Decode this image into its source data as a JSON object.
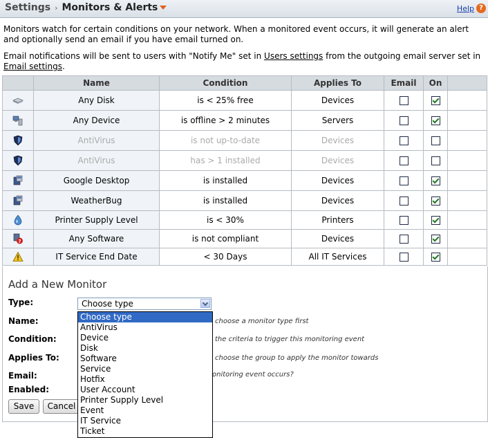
{
  "header": {
    "breadcrumb_root": "Settings",
    "breadcrumb_sep": "›",
    "breadcrumb_current": "Monitors & Alerts",
    "help_label": "Help",
    "help_icon": "?"
  },
  "intro": {
    "line1": "Monitors watch for certain conditions on your network. When a monitored event occurs, it will generate an alert and optionally send an email if you have email turned on.",
    "line2_pre": "Email notifications will be sent to users with \"Notify Me\" set in ",
    "line2_link1": "Users settings",
    "line2_mid": " from the outgoing email server set in ",
    "line2_link2": "Email settings",
    "line2_post": "."
  },
  "table": {
    "headers": [
      "Name",
      "Condition",
      "Applies To",
      "Email",
      "On"
    ],
    "rows": [
      {
        "icon": "disk-icon",
        "name": "Any Disk",
        "condition": "is < 25% free",
        "applies_to": "Devices",
        "email": false,
        "on": true,
        "enabled": true
      },
      {
        "icon": "device-icon",
        "name": "Any Device",
        "condition": "is offline > 2 minutes",
        "applies_to": "Servers",
        "email": false,
        "on": true,
        "enabled": true
      },
      {
        "icon": "antivirus-shield-icon",
        "name": "AntiVirus",
        "condition": "is not up-to-date",
        "applies_to": "Devices",
        "email": false,
        "on": false,
        "enabled": false
      },
      {
        "icon": "antivirus-shield-icon",
        "name": "AntiVirus",
        "condition": "has > 1 installed",
        "applies_to": "Devices",
        "email": false,
        "on": false,
        "enabled": false
      },
      {
        "icon": "software-install-icon",
        "name": "Google Desktop",
        "condition": "is installed",
        "applies_to": "Devices",
        "email": false,
        "on": true,
        "enabled": true
      },
      {
        "icon": "software-install-icon",
        "name": "WeatherBug",
        "condition": "is installed",
        "applies_to": "Devices",
        "email": false,
        "on": true,
        "enabled": true
      },
      {
        "icon": "ink-drop-icon",
        "name": "Printer Supply Level",
        "condition": "is < 30%",
        "applies_to": "Printers",
        "email": false,
        "on": true,
        "enabled": true
      },
      {
        "icon": "software-compliance-icon",
        "name": "Any Software",
        "condition": "is not compliant",
        "applies_to": "Devices",
        "email": false,
        "on": true,
        "enabled": true
      },
      {
        "icon": "warning-triangle-icon",
        "name": "IT Service End Date",
        "condition": "< 30 Days",
        "applies_to": "All IT Services",
        "email": false,
        "on": true,
        "enabled": true
      }
    ]
  },
  "add_monitor": {
    "title": "Add a New Monitor",
    "labels": {
      "type": "Type:",
      "name": "Name:",
      "condition": "Condition:",
      "applies_to": "Applies To:",
      "email": "Email:",
      "enabled": "Enabled:"
    },
    "hints": {
      "name": "choose a monitor type first",
      "condition": "the criteria to trigger this monitoring event",
      "applies_to": "choose the group to apply the monitor towards",
      "email": "onitoring event occurs?"
    },
    "type_select_value": "Choose type",
    "type_options": [
      "Choose type",
      "AntiVirus",
      "Device",
      "Disk",
      "Software",
      "Service",
      "Hotfix",
      "User Account",
      "Printer Supply Level",
      "Event",
      "IT Service",
      "Ticket"
    ],
    "save_label": "Save",
    "cancel_label": "Cancel"
  }
}
